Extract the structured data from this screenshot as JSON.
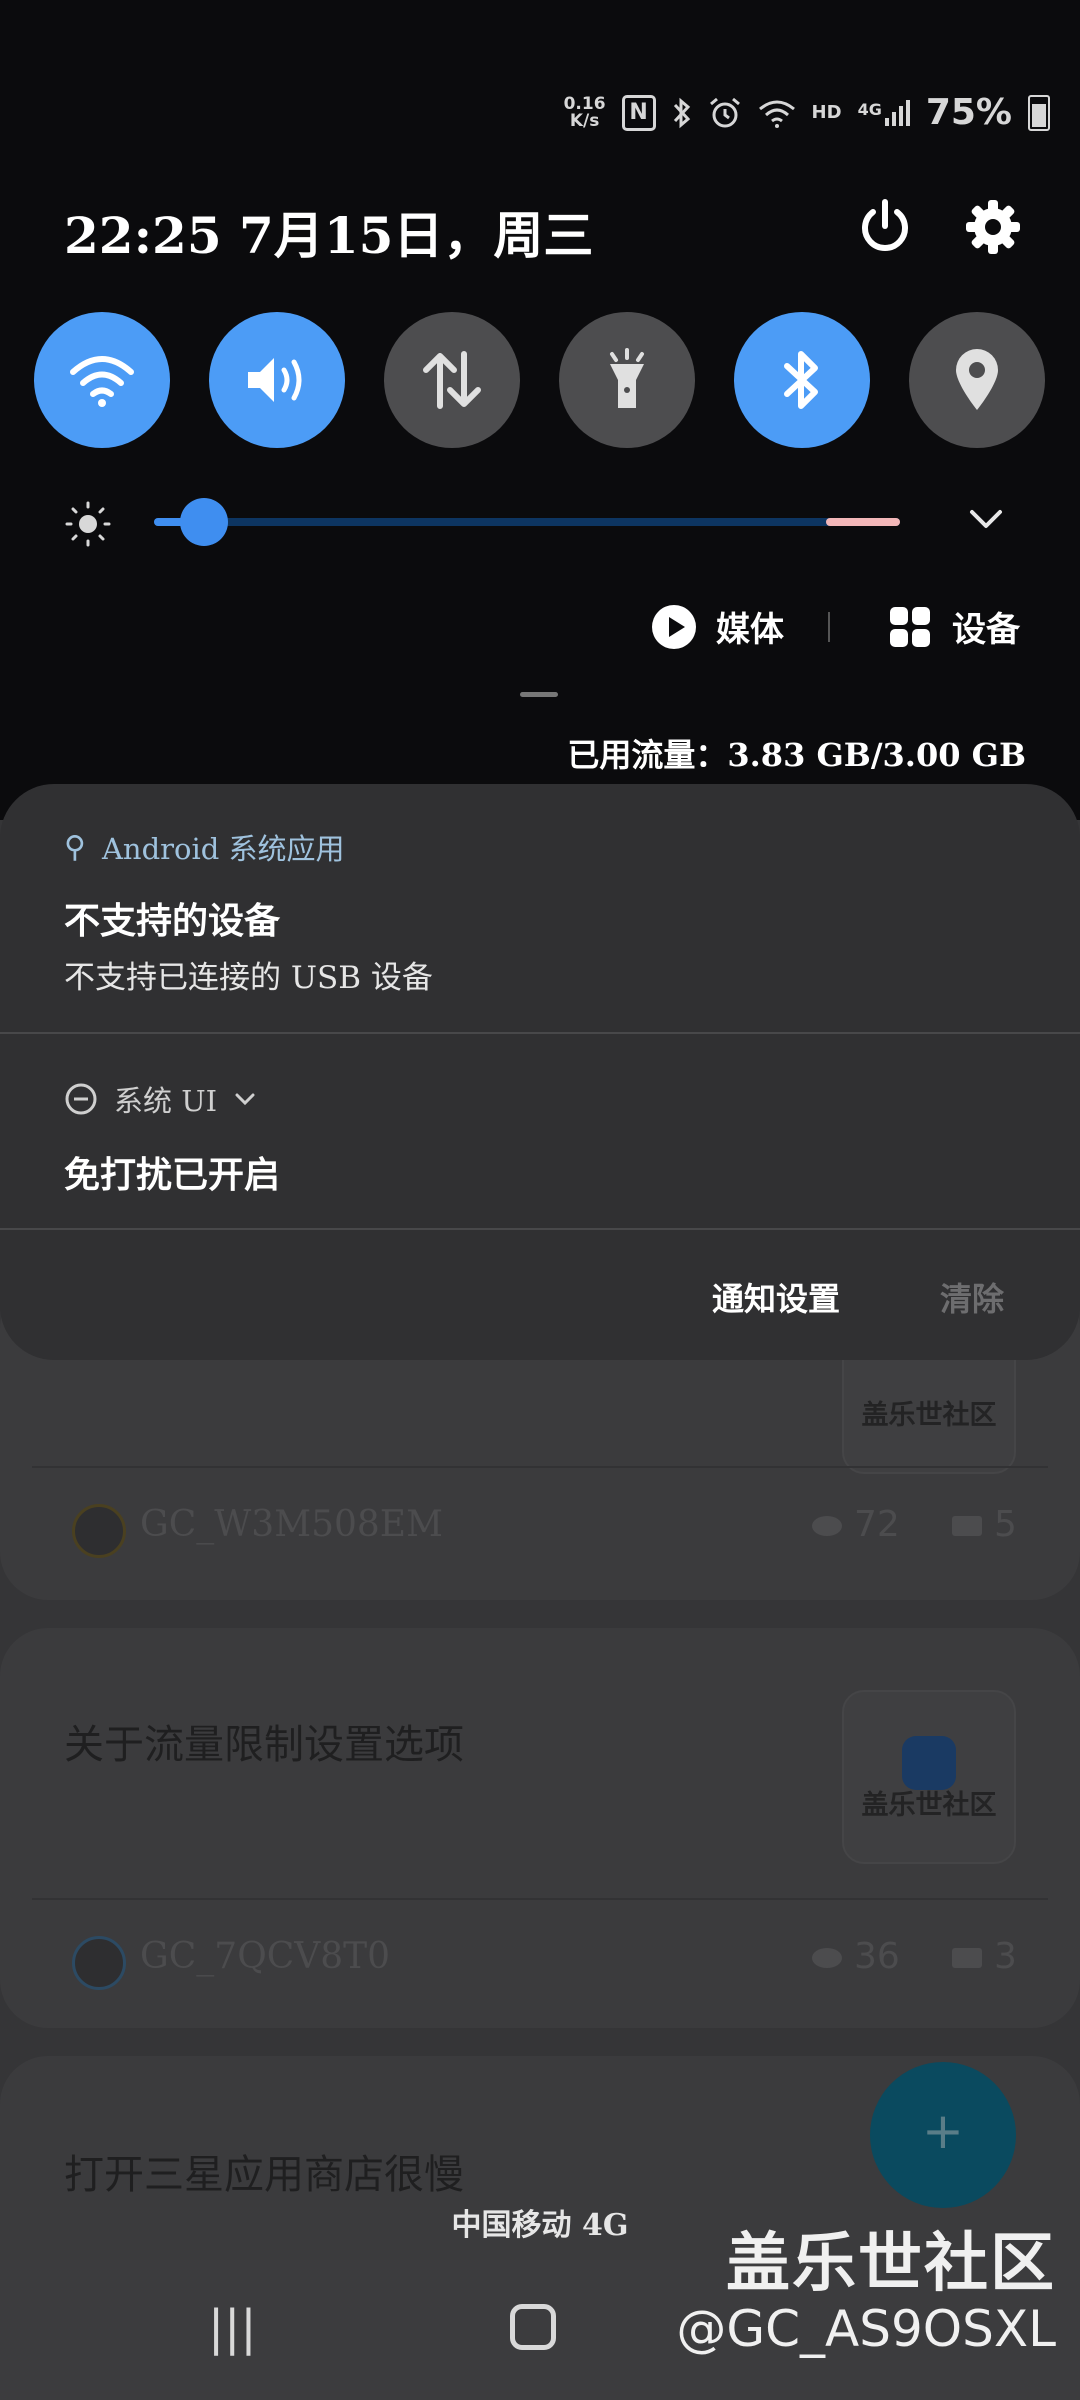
{
  "status_bar": {
    "net_speed_value": "0.16",
    "net_speed_unit": "K/s",
    "network_type": "HD",
    "signal_gen": "4G",
    "battery": "75%"
  },
  "header": {
    "datetime": "22:25 7月15日，周三"
  },
  "quick_settings": {
    "tiles": [
      {
        "name": "wifi",
        "state": "on"
      },
      {
        "name": "sound",
        "state": "on"
      },
      {
        "name": "mobile-data",
        "state": "off"
      },
      {
        "name": "flashlight",
        "state": "off"
      },
      {
        "name": "bluetooth",
        "state": "on"
      },
      {
        "name": "location",
        "state": "off"
      }
    ],
    "brightness_level": 0.05
  },
  "media_label": "媒体",
  "devices_label": "设备",
  "data_usage": "已用流量：3.83 GB/3.00 GB",
  "notifications": [
    {
      "app": "Android 系统应用",
      "title": "不支持的设备",
      "text": "不支持已连接的 USB 设备"
    },
    {
      "app": "系统 UI",
      "title": "免打扰已开启"
    }
  ],
  "actions": {
    "settings": "通知设置",
    "clear": "清除"
  },
  "background_app": {
    "cards": [
      {
        "thumb_text": "盖乐世社区",
        "author": "GC_W3M508EM",
        "views": "72",
        "comments": "5"
      },
      {
        "title": "关于流量限制设置选项",
        "thumb_text": "盖乐世社区",
        "author": "GC_7QCV8T0",
        "views": "36",
        "comments": "3"
      },
      {
        "title": "打开三星应用商店很慢"
      }
    ],
    "fab": "+"
  },
  "carrier": "中国移动 4G",
  "watermark": {
    "brand": "盖乐世社区",
    "handle": "@GC_AS9OSXL"
  },
  "colors": {
    "accent": "#4c9cf6",
    "tile_off": "#4d4d4f",
    "panel": "#303032",
    "app_label": "#9fc2de"
  }
}
